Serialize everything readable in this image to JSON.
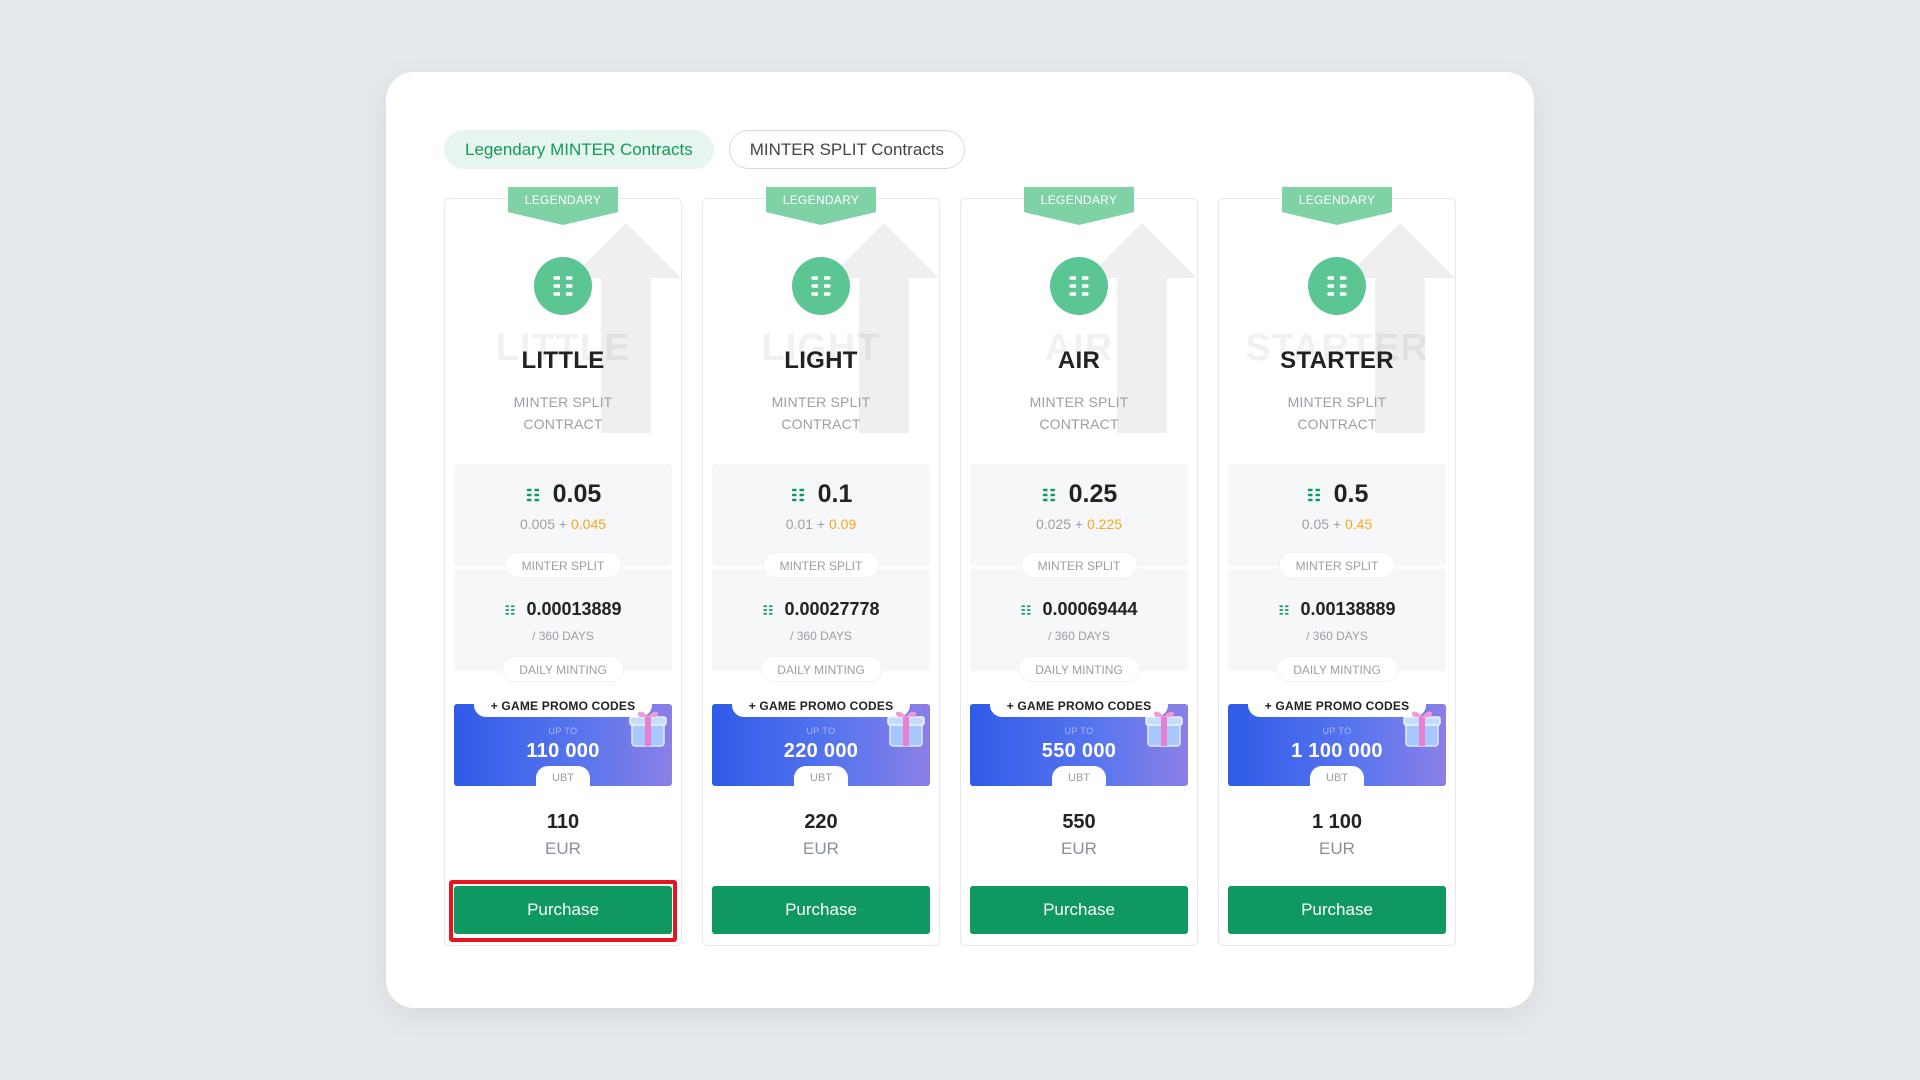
{
  "tabs": [
    {
      "label": "Legendary MINTER Contracts",
      "active": true
    },
    {
      "label": "MINTER SPLIT Contracts",
      "active": false
    }
  ],
  "colors": {
    "accent": "#0f9960",
    "badge": "#7fd1a6",
    "bonus": "#f5a623",
    "promo_start": "#2f5be8",
    "promo_end": "#8c7fe6",
    "highlight": "#e8141b"
  },
  "cards": [
    {
      "badge": "LEGENDARY",
      "icon": "coin-stack-icon",
      "name": "LITTLE",
      "subtitle_line1": "MINTER SPLIT",
      "subtitle_line2": "CONTRACT",
      "price": "0.05",
      "price_base": "0.005",
      "price_bonus": "0.045",
      "split_label": "MINTER SPLIT",
      "daily": "0.00013889",
      "daily_period": "/ 360 DAYS",
      "daily_label": "DAILY MINTING",
      "promo_title": "+ GAME PROMO CODES",
      "promo_upto": "UP TO",
      "promo_amount": "110 000",
      "promo_unit": "UBT",
      "eur": "110",
      "currency": "EUR",
      "button": "Purchase"
    },
    {
      "badge": "LEGENDARY",
      "icon": "coin-stack-icon",
      "name": "LIGHT",
      "subtitle_line1": "MINTER SPLIT",
      "subtitle_line2": "CONTRACT",
      "price": "0.1",
      "price_base": "0.01",
      "price_bonus": "0.09",
      "split_label": "MINTER SPLIT",
      "daily": "0.00027778",
      "daily_period": "/ 360 DAYS",
      "daily_label": "DAILY MINTING",
      "promo_title": "+ GAME PROMO CODES",
      "promo_upto": "UP TO",
      "promo_amount": "220 000",
      "promo_unit": "UBT",
      "eur": "220",
      "currency": "EUR",
      "button": "Purchase"
    },
    {
      "badge": "LEGENDARY",
      "icon": "coin-stack-icon",
      "name": "AIR",
      "subtitle_line1": "MINTER SPLIT",
      "subtitle_line2": "CONTRACT",
      "price": "0.25",
      "price_base": "0.025",
      "price_bonus": "0.225",
      "split_label": "MINTER SPLIT",
      "daily": "0.00069444",
      "daily_period": "/ 360 DAYS",
      "daily_label": "DAILY MINTING",
      "promo_title": "+ GAME PROMO CODES",
      "promo_upto": "UP TO",
      "promo_amount": "550 000",
      "promo_unit": "UBT",
      "eur": "550",
      "currency": "EUR",
      "button": "Purchase"
    },
    {
      "badge": "LEGENDARY",
      "icon": "coin-stack-icon",
      "name": "STARTER",
      "subtitle_line1": "MINTER SPLIT",
      "subtitle_line2": "CONTRACT",
      "price": "0.5",
      "price_base": "0.05",
      "price_bonus": "0.45",
      "split_label": "MINTER SPLIT",
      "daily": "0.00138889",
      "daily_period": "/ 360 DAYS",
      "daily_label": "DAILY MINTING",
      "promo_title": "+ GAME PROMO CODES",
      "promo_upto": "UP TO",
      "promo_amount": "1 100 000",
      "promo_unit": "UBT",
      "eur": "1 100",
      "currency": "EUR",
      "button": "Purchase"
    }
  ]
}
